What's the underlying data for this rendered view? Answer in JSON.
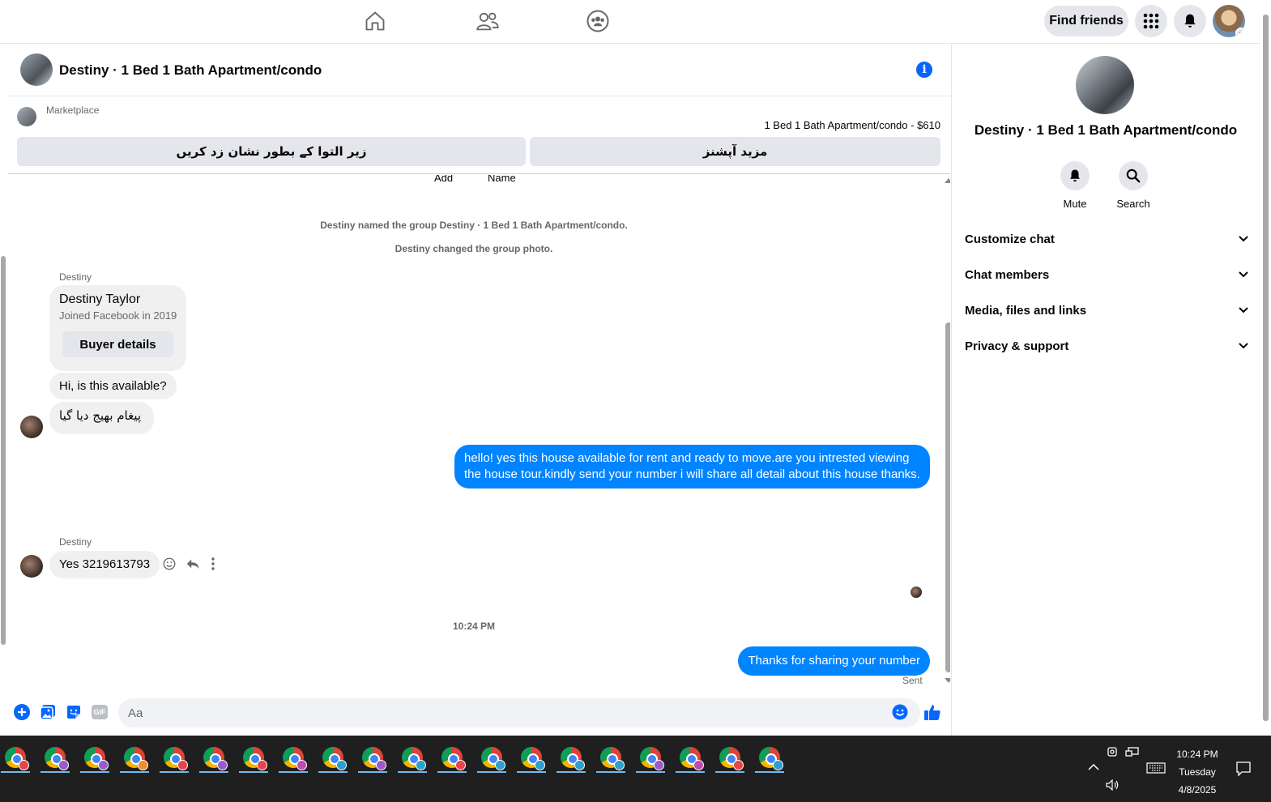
{
  "topnav": {
    "find_friends": "Find friends"
  },
  "chat": {
    "title": "Destiny · 1 Bed 1 Bath Apartment/condo",
    "marketplace_label": "Marketplace",
    "listing_price": "1 Bed 1 Bath Apartment/condo - $610",
    "btn_mark_pending": "زیر التوا کے بطور نشان زد کریں",
    "btn_more_options": "مزید آپشنز",
    "partial_labels": [
      "Add",
      "Name"
    ],
    "system_messages": [
      "Destiny named the group Destiny · 1 Bed 1 Bath Apartment/condo.",
      "Destiny changed the group photo."
    ],
    "sender_1": "Destiny",
    "profile_card": {
      "name": "Destiny Taylor",
      "joined": "Joined Facebook in 2019",
      "button": "Buyer details"
    },
    "msg_in_1": "Hi, is this available?",
    "msg_in_2": "پیغام بھیج دیا گیا",
    "msg_out_1_line1": "hello! yes this house available for rent and ready to move.are you intrested viewing",
    "msg_out_1_line2": "the house tour.kindly send your number i will share all detail about this house thanks.",
    "sender_2": "Destiny",
    "msg_in_3": "Yes 3219613793",
    "timestamp": "10:24 PM",
    "msg_out_2": "Thanks for sharing your number",
    "status": "Sent",
    "composer_placeholder": "Aa"
  },
  "right_panel": {
    "title": "Destiny · 1 Bed 1 Bath Apartment/condo",
    "actions": [
      {
        "label": "Mute",
        "icon": "bell-icon"
      },
      {
        "label": "Search",
        "icon": "search-icon"
      }
    ],
    "sections": [
      "Customize chat",
      "Chat members",
      "Media, files and links",
      "Privacy & support"
    ]
  },
  "taskbar": {
    "time": "10:24 PM",
    "day": "Tuesday",
    "date": "4/8/2025",
    "profile_colors": [
      "#e8454a",
      "#9b59d0",
      "#9b59d0",
      "#f08c2a",
      "#e8454a",
      "#9b59d0",
      "#e8454a",
      "#c04ab0",
      "#2aa0d0",
      "#9b59d0",
      "#2aa0d0",
      "#e8454a",
      "#2aa0d0",
      "#2aa0d0",
      "#2aa0d0",
      "#2aa0d0",
      "#9b59d0",
      "#c04ab0",
      "#e8454a",
      "#2aa0d0"
    ]
  },
  "colors": {
    "accent": "#0866ff",
    "outgoing_bubble": "#0084ff",
    "incoming_bubble": "#f0f0f0"
  }
}
